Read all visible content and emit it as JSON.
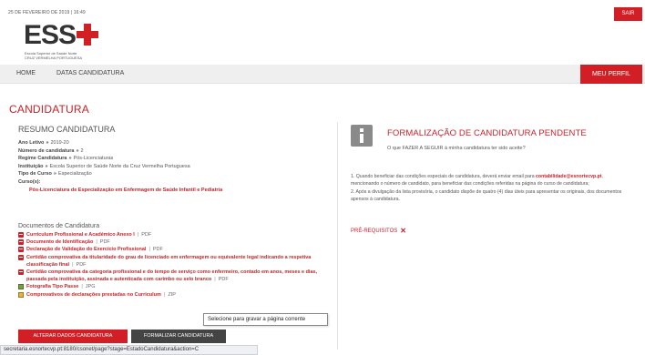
{
  "header": {
    "date": "25 DE FEVEREIRO DE 2019 | 16:49",
    "logout_label": "SAIR",
    "logo": {
      "text": "ESS",
      "subtitle_1": "Escola Superior de Saúde Norte",
      "subtitle_2": "CRUZ VERMELHA PORTUGUESA"
    }
  },
  "nav": {
    "items": [
      {
        "label": "HOME"
      },
      {
        "label": "DATAS CANDIDATURA"
      }
    ],
    "profile_label": "MEU PERFIL"
  },
  "page_title": "CANDIDATURA",
  "resumo": {
    "title": "RESUMO CANDIDATURA",
    "fields": [
      {
        "label": "Ano Letivo",
        "value": "2019-20"
      },
      {
        "label": "Número de candidatura",
        "value": "2"
      },
      {
        "label": "Regime Candidatura",
        "value": "Pós-Licenciaturas"
      },
      {
        "label": "Instituição",
        "value": "Escola Superior de Saúde Norte da Cruz Vermelha Portuguesa"
      },
      {
        "label": "Tipo de Curso",
        "value": "Especialização"
      }
    ],
    "curso_label": "Curso(s):",
    "curso_value": "Pós-Licenciatura de Especialização em Enfermagem de Saúde Infantil e Pediatria"
  },
  "documents": {
    "title": "Documentos de Candidatura",
    "items": [
      {
        "name": "Curriculum Profissional e Académico Anexo I",
        "ext": "PDF",
        "icon": "pdf-icon"
      },
      {
        "name": "Documento de Identificação",
        "ext": "PDF",
        "icon": "pdf-icon"
      },
      {
        "name": "Declaração de Validação do Exercício Profissional",
        "ext": "PDF",
        "icon": "pdf-icon"
      },
      {
        "name": "Certidão comprovativa da titularidade do grau de licenciado em enfermagem ou equivalente legal indicando a respetiva classificação final",
        "ext": "PDF",
        "icon": "pdf-icon"
      },
      {
        "name": "Certidão comprovativa da categoria profissional e do tempo de serviço como enfermeiro, contado em anos, meses e dias, passada pela instituição, assinada e autenticada com carimbo ou selo branco",
        "ext": "PDF",
        "icon": "pdf-icon"
      },
      {
        "name": "Fotografia Tipo Passe",
        "ext": "JPG",
        "icon": "image-icon"
      },
      {
        "name": "Comprovativos de declarações prestadas no Curriculum",
        "ext": "ZIP",
        "icon": "zip-icon"
      }
    ]
  },
  "tooltip": "Selecione para gravar a página corrente",
  "buttons": {
    "alterar": "ALTERAR DADOS CANDIDATURA",
    "formalizar": "FORMALIZAR CANDIDATURA"
  },
  "statusbar": "secretaria.esnortecvp.pt:8180/csonet/page?stage=EstadoCandidatura&action=C",
  "formalizacao": {
    "title": "FORMALIZAÇÃO DE CANDIDATURA PENDENTE",
    "subtitle": "O que FAZER A SEGUIR à minha candidatura ter sido aceite?",
    "para1_a": "1. Quando beneficiar das condições especiais de candidatura, deverá enviar email para",
    "email": "contabilidade@esnortecvp.pt",
    "para1_b": ", mencionando o número de candidato, para beneficiar das condições referidas na página do curso de candidatura;",
    "para2": "2. Após a divulgação da lista provisória, o candidato dispõe de quatro (4) dias úteis para apresentar os originais, dos documentos apensos à candidatura.",
    "prereq_label": "PRÉ-REQUISITOS"
  },
  "colors": {
    "accent": "#d21f26",
    "dark_button": "#444444"
  }
}
